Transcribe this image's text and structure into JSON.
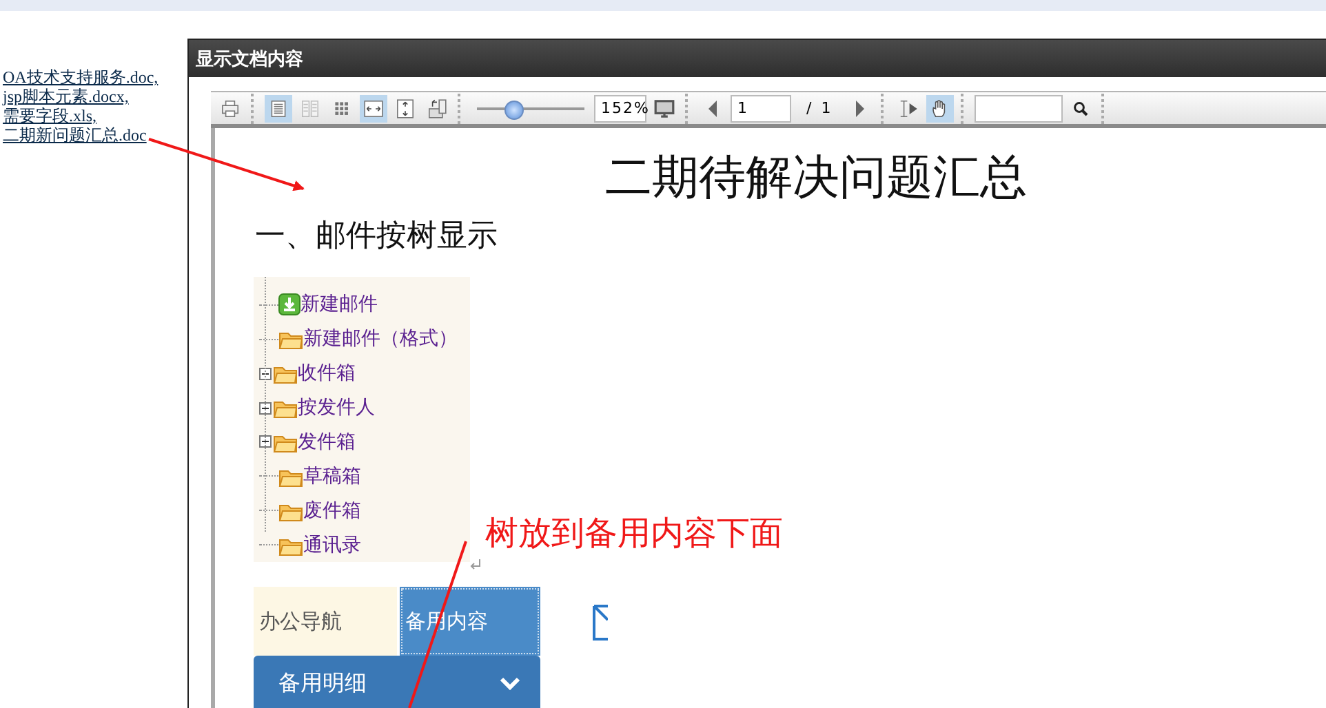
{
  "files": [
    {
      "name": "OA技术支持服务.doc,"
    },
    {
      "name": "jsp脚本元素.docx,"
    },
    {
      "name": "需要字段.xls,"
    },
    {
      "name": "二期新问题汇总.doc"
    }
  ],
  "dialog": {
    "title": "显示文档内容"
  },
  "toolbar": {
    "tools": [
      {
        "kind": "print",
        "selected": false,
        "disabled": false
      },
      {
        "kind": "single-page",
        "selected": true,
        "disabled": false
      },
      {
        "kind": "two-page",
        "selected": false,
        "disabled": true
      },
      {
        "kind": "grid",
        "selected": false,
        "disabled": false
      },
      {
        "kind": "fit-width",
        "selected": true,
        "disabled": false
      },
      {
        "kind": "fit-height",
        "selected": false,
        "disabled": false
      },
      {
        "kind": "rotate",
        "selected": false,
        "disabled": false
      }
    ],
    "zoom": {
      "level": 0.35,
      "value": "152%"
    },
    "page": {
      "value": "1",
      "total": "/  1"
    },
    "modes": [
      {
        "kind": "text-select",
        "selected": false
      },
      {
        "kind": "hand",
        "selected": true
      }
    ]
  },
  "document": {
    "title": "二期待解决问题汇总",
    "heading": "一、邮件按树显示",
    "tree": [
      {
        "label": "新建邮件",
        "kind": "new"
      },
      {
        "label": "新建邮件（格式）",
        "kind": "leaf"
      },
      {
        "label": "收件箱",
        "kind": "node",
        "expanded": true
      },
      {
        "label": "按发件人",
        "kind": "node",
        "expanded": true
      },
      {
        "label": "发件箱",
        "kind": "node",
        "expanded": true
      },
      {
        "label": "草稿箱",
        "kind": "leaf"
      },
      {
        "label": "废件箱",
        "kind": "leaf"
      },
      {
        "label": "通讯录",
        "kind": "leaf"
      }
    ],
    "annotation": "树放到备用内容下面",
    "nav_tabs": [
      {
        "label": "办公导航",
        "selected": false
      },
      {
        "label": "备用内容",
        "selected": true
      }
    ],
    "panel_header": {
      "label": "备用明细"
    }
  }
}
